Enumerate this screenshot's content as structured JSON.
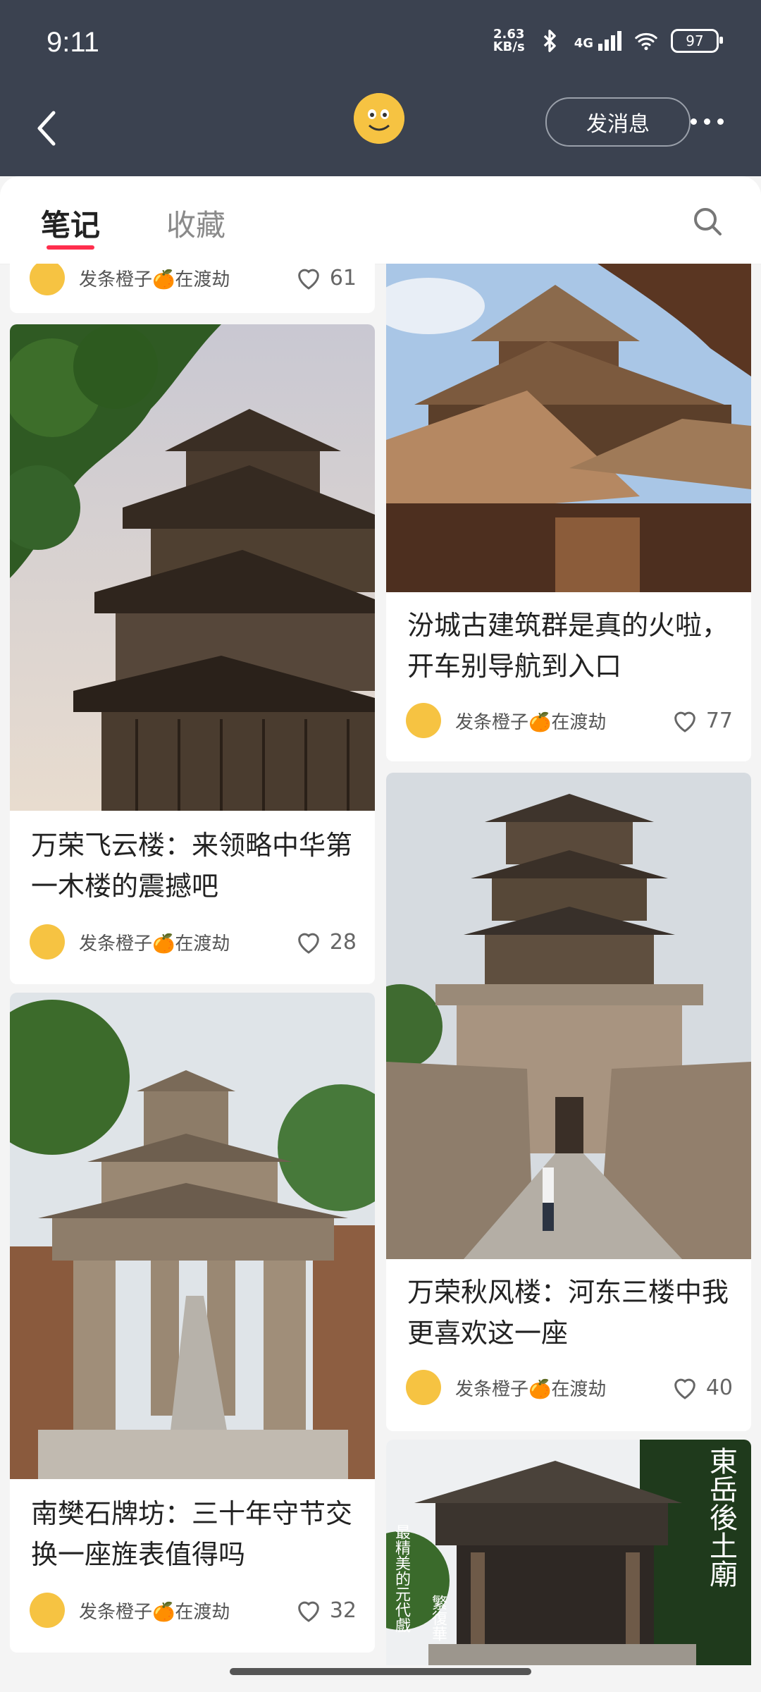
{
  "status_bar": {
    "time": "9:11",
    "net_speed_value": "2.63",
    "net_speed_unit": "KB/s",
    "network_label": "4G",
    "battery": "97"
  },
  "header": {
    "message_button": "发消息"
  },
  "tabs": [
    {
      "label": "笔记",
      "active": true
    },
    {
      "label": "收藏",
      "active": false
    }
  ],
  "posts": [
    {
      "title": "",
      "author": "发条橙子🍊在渡劫",
      "likes": "61"
    },
    {
      "title": "万荣飞云楼：来领略中华第一木楼的震撼吧",
      "author": "发条橙子🍊在渡劫",
      "likes": "28"
    },
    {
      "title": "南樊石牌坊：三十年守节交换一座旌表值得吗",
      "author": "发条橙子🍊在渡劫",
      "likes": "32"
    },
    {
      "title": "汾城古建筑群是真的火啦，开车别导航到入口",
      "author": "发条橙子🍊在渡劫",
      "likes": "77"
    },
    {
      "title": "万荣秋风楼：河东三楼中我更喜欢这一座",
      "author": "发条橙子🍊在渡劫",
      "likes": "40"
    },
    {
      "title": "",
      "overlay_text_right": "東岳後土廟",
      "overlay_text_left_1": "最精美的元代戲",
      "overlay_text_left_2": "繁復華"
    }
  ],
  "colors": {
    "header_bg": "#3b4250",
    "accent": "#ff2e4d",
    "avatar": "#f6c342"
  }
}
